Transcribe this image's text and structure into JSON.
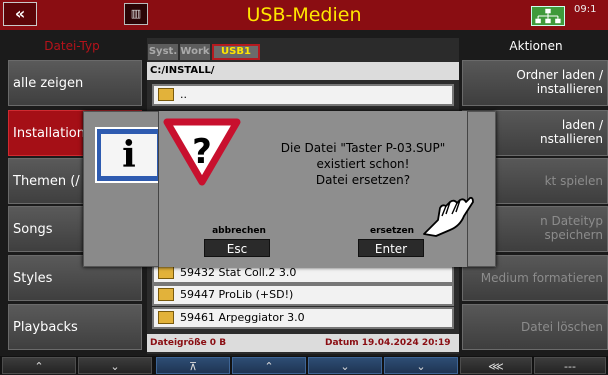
{
  "topbar": {
    "back_label": "«",
    "trash_label": "▥",
    "title": "USB-Medien",
    "clock": "09:1",
    "net_icon": "network-tree-icon"
  },
  "left_panel": {
    "header": "Datei-Typ",
    "items": [
      {
        "label": "alle zeigen"
      },
      {
        "label": "Installation"
      },
      {
        "label": "Themen (/"
      },
      {
        "label": "Songs"
      },
      {
        "label": "Styles"
      },
      {
        "label": "Playbacks"
      }
    ]
  },
  "right_panel": {
    "header": "Aktionen",
    "items": [
      {
        "line1": "Ordner laden  /",
        "line2": "installieren"
      },
      {
        "line1": "laden  /",
        "line2": "nstallieren"
      },
      {
        "line1": "kt spielen",
        "line2": ""
      },
      {
        "line1": "n Dateityp",
        "line2": "speichern"
      },
      {
        "line1": "Medium formatieren",
        "line2": ""
      },
      {
        "line1": "Datei löschen",
        "line2": ""
      }
    ]
  },
  "center": {
    "tabs": [
      "Syst.",
      "Work",
      "USB1"
    ],
    "path": "C:/INSTALL/",
    "rows": [
      "..",
      "59432  Stat Coll.2  3.0",
      "59447  ProLib (+SD!)",
      "59461  Arpeggiator 3.0"
    ],
    "status": {
      "size_label": "Dateigröße  0 B",
      "date_label": "Datum  19.04.2024   20:19"
    }
  },
  "dialog": {
    "message": [
      "Die Datei \"Taster P-03.SUP\"",
      "existiert schon!",
      "Datei ersetzen?"
    ],
    "cancel_caption": "abbrechen",
    "cancel_label": "Esc",
    "confirm_caption": "ersetzen",
    "confirm_label": "Enter",
    "info_glyph": "i",
    "warn_glyph": "?"
  },
  "bottombar": {
    "buttons": [
      "⌃",
      "⌄",
      "⊼",
      "⌃",
      "⌄",
      "⌄",
      "⋘",
      "---"
    ]
  },
  "colors": {
    "accent_red": "#8a0d12",
    "title_yellow": "#ffe600",
    "active_red": "#a50f16"
  }
}
